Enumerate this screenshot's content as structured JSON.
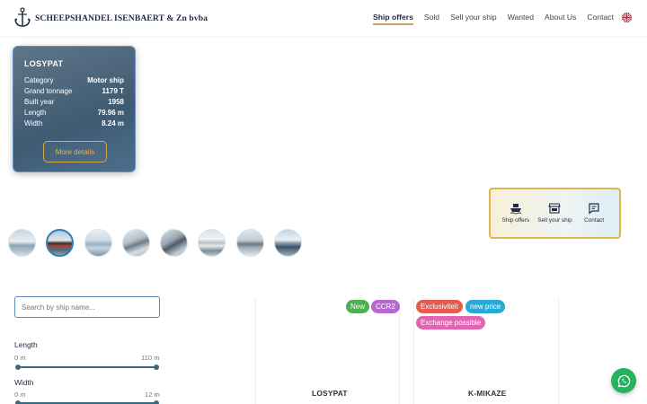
{
  "header": {
    "brand": "SCHEEPSHANDEL ISENBAERT & Zn bvba",
    "nav": [
      "Ship offers",
      "Sold",
      "Sell your ship",
      "Wanted",
      "About Us",
      "Contact"
    ],
    "active_nav": "Ship offers",
    "language_icon": "uk-flag-icon"
  },
  "hero": {
    "ship_name": "LOSYPAT",
    "specs": [
      {
        "label": "Category",
        "value": "Motor ship"
      },
      {
        "label": "Grand tonnage",
        "value": "1179 T"
      },
      {
        "label": "Built year",
        "value": "1958"
      },
      {
        "label": "Length",
        "value": "79.96 m"
      },
      {
        "label": "Width",
        "value": "8.24 m"
      }
    ],
    "button": "More details"
  },
  "quick_links": [
    {
      "label": "Ship offers",
      "icon": "ship-icon"
    },
    {
      "label": "Sell your ship",
      "icon": "store-icon"
    },
    {
      "label": "Contact",
      "icon": "chat-icon"
    }
  ],
  "thumbnails": {
    "count": 8,
    "active_index": 1
  },
  "filters": {
    "search_placeholder": "Search by ship name...",
    "length": {
      "title": "Length",
      "min": "0 m",
      "max": "110 m"
    },
    "width": {
      "title": "Width",
      "min": "0 m",
      "max": "12 m"
    }
  },
  "listings": [
    {
      "name": "LOSYPAT",
      "badges": [
        {
          "text": "New",
          "color": "#4caf50"
        },
        {
          "text": "CCR2",
          "color": "#b868d0"
        }
      ]
    },
    {
      "name": "K-MIKAZE",
      "badges": [
        {
          "text": "Exclusiviteit",
          "color": "#e85a4f"
        },
        {
          "text": "new price",
          "color": "#29a9d6"
        },
        {
          "text": "Exchange possible",
          "color": "#e066b3"
        }
      ]
    }
  ],
  "colors": {
    "accent": "#c9a46a",
    "primary": "#1f2a44",
    "whatsapp": "#25b45d"
  }
}
